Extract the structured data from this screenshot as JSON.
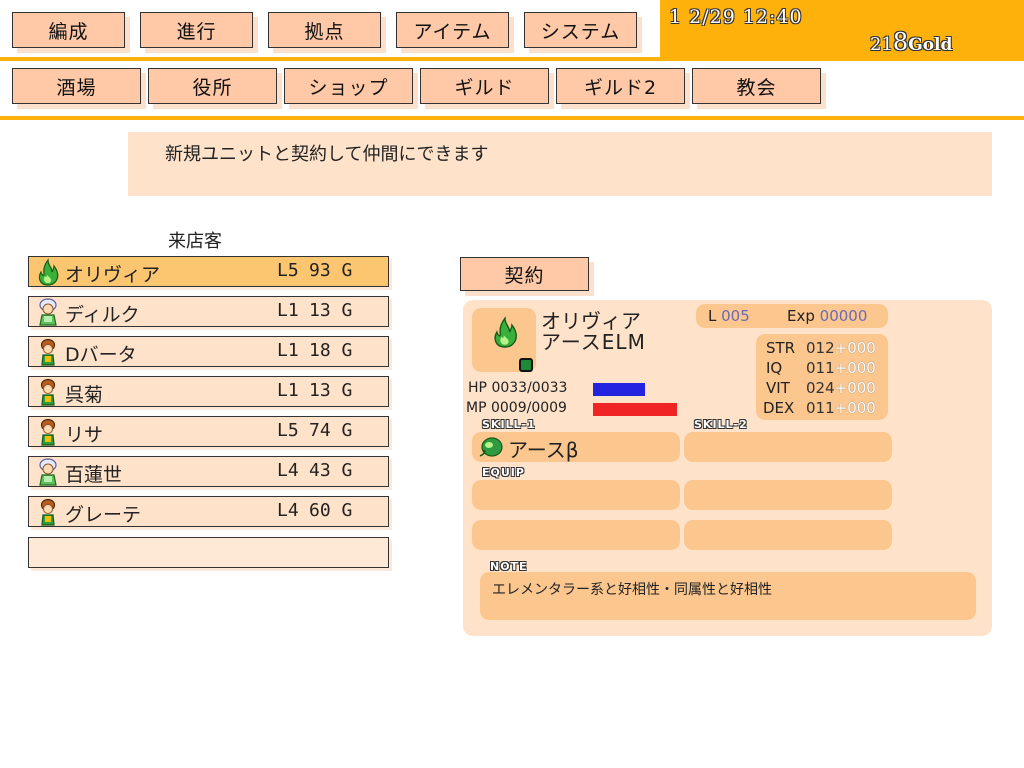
{
  "top_menu": [
    "編成",
    "進行",
    "拠点",
    "アイテム",
    "システム"
  ],
  "sub_menu": [
    "酒場",
    "役所",
    "ショップ",
    "ギルド",
    "ギルド2",
    "教会"
  ],
  "status": {
    "date_time": "1 2/29 12:40",
    "gold_prefix": "21",
    "gold_last": "8",
    "gold_unit": "Gold"
  },
  "info_text": "新規ユニットと契約して仲間にできます",
  "list_title": "来店客",
  "units": [
    {
      "name": "オリヴィア",
      "level": "L5",
      "cost": "93 G",
      "icon": "green-flame-icon"
    },
    {
      "name": "ディルク",
      "level": "L1",
      "cost": "13 G",
      "icon": "white-haired-unit-icon"
    },
    {
      "name": "Dバータ",
      "level": "L1",
      "cost": "18 G",
      "icon": "brown-haired-unit-icon"
    },
    {
      "name": "呉菊",
      "level": "L1",
      "cost": "13 G",
      "icon": "brown-haired-unit-icon"
    },
    {
      "name": "リサ",
      "level": "L5",
      "cost": "74 G",
      "icon": "brown-haired-unit-icon"
    },
    {
      "name": "百蓮世",
      "level": "L4",
      "cost": "43 G",
      "icon": "white-haired-unit-icon"
    },
    {
      "name": "グレーテ",
      "level": "L4",
      "cost": "60 G",
      "icon": "brown-haired-unit-icon"
    }
  ],
  "contract_label": "契約",
  "detail": {
    "name": "オリヴィア",
    "race": "アースELM",
    "level_label": "L",
    "level_value": "005",
    "exp_label": "Exp",
    "exp_value": "00000",
    "hp_label": "HP",
    "hp_value": "0033/0033",
    "mp_label": "MP",
    "mp_value": "0009/0009",
    "stats": [
      {
        "label": "STR",
        "value": "012",
        "bonus": "+000"
      },
      {
        "label": "IQ",
        "value": "011",
        "bonus": "+000"
      },
      {
        "label": "VIT",
        "value": "024",
        "bonus": "+000"
      },
      {
        "label": "DEX",
        "value": "011",
        "bonus": "+000"
      }
    ],
    "skill1_tag": "SKILL-1",
    "skill2_tag": "SKILL-2",
    "equip_tag": "EQUIP",
    "note_tag": "NOTE",
    "skill1_name": "アースβ",
    "note_text": "エレメンタラー系と好相性・同属性と好相性",
    "colors": {
      "hp_bar": "#2424e0",
      "mp_bar": "#f02424"
    }
  }
}
